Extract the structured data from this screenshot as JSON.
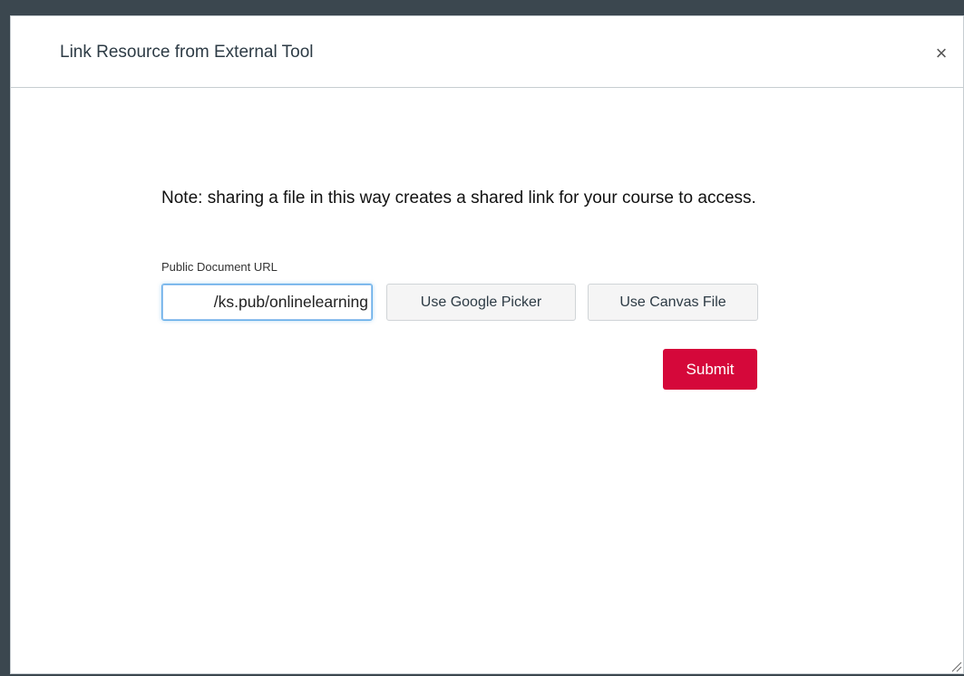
{
  "dialog": {
    "title": "Link Resource from External Tool",
    "close_label": "×"
  },
  "form": {
    "note": "Note: sharing a file in this way creates a shared link for your course to access.",
    "url_label": "Public Document URL",
    "url_value": "ks.pub/onlinelearning/",
    "google_picker_label": "Use Google Picker",
    "canvas_file_label": "Use Canvas File",
    "submit_label": "Submit"
  },
  "colors": {
    "submit": "#d5083a",
    "backdrop": "#3b474f"
  }
}
